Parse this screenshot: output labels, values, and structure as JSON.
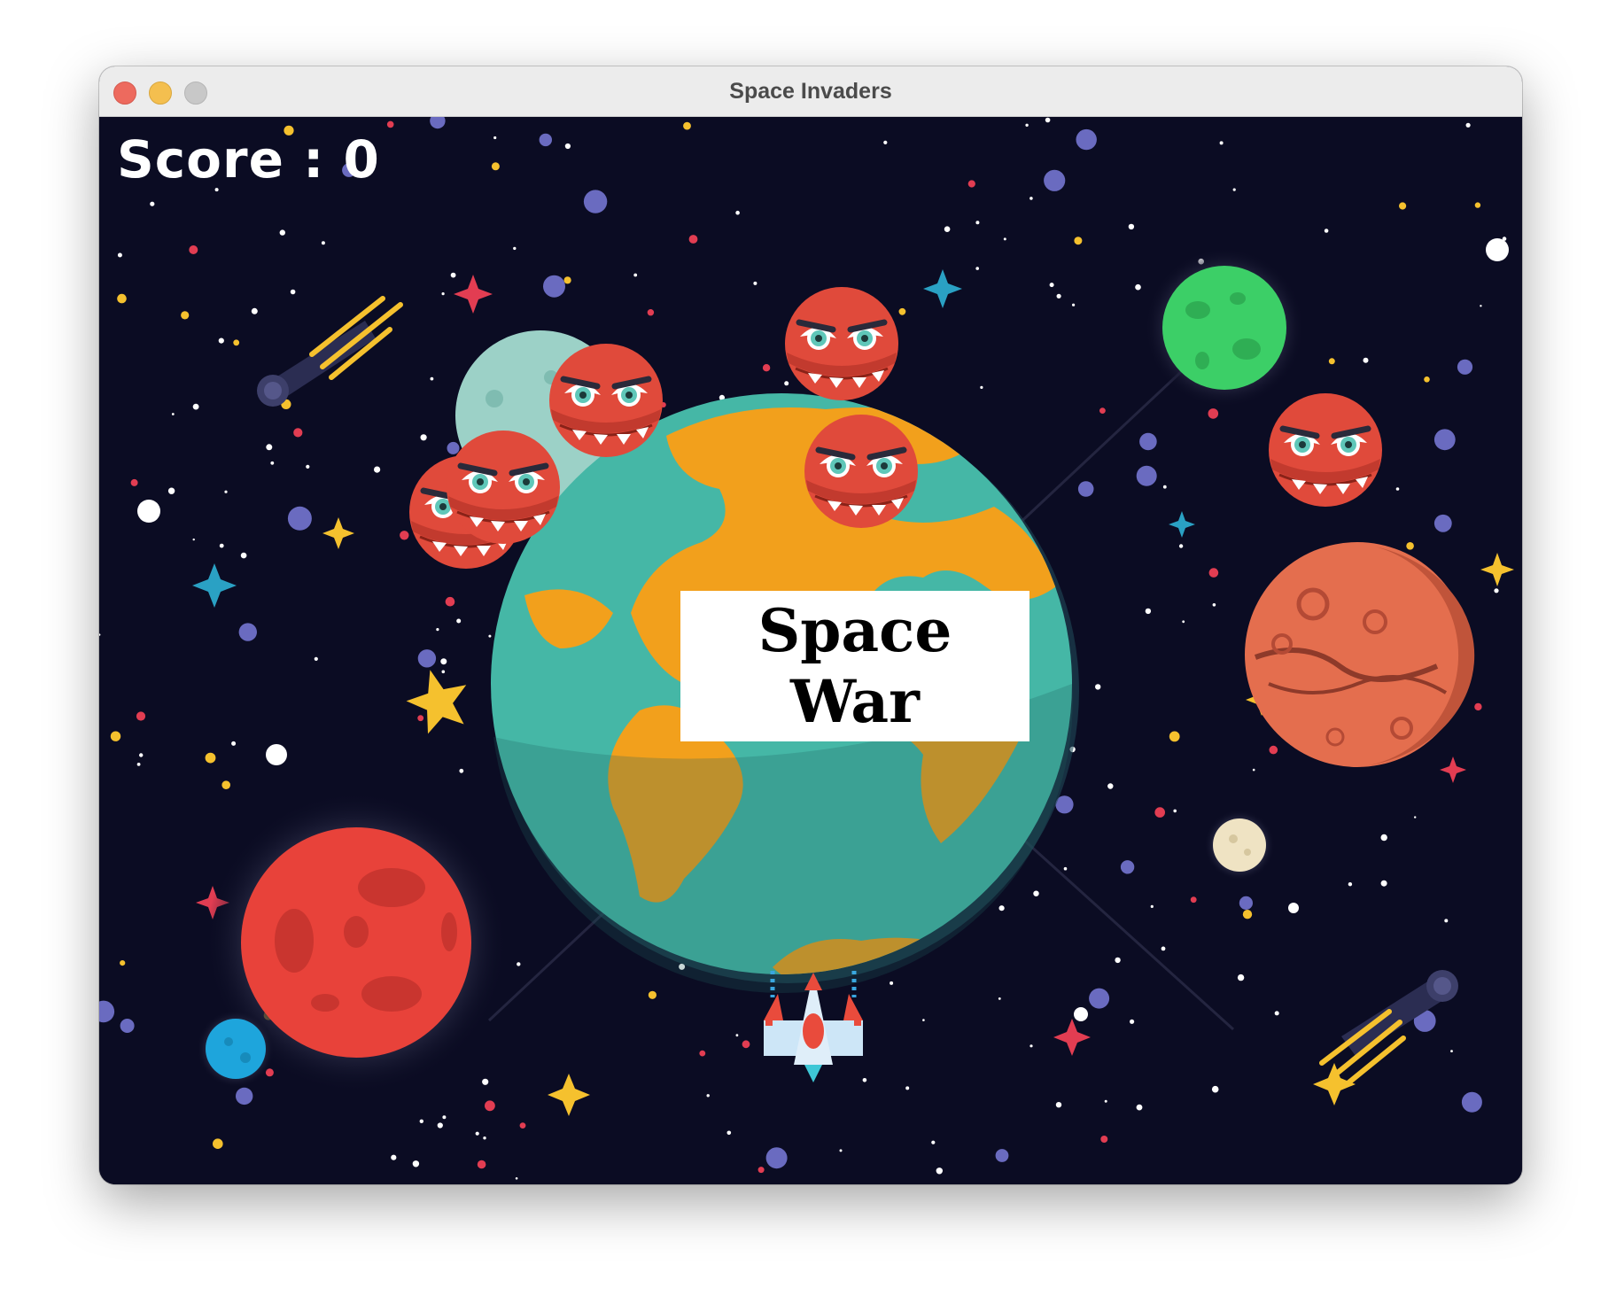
{
  "window": {
    "title": "Space Invaders"
  },
  "hud": {
    "score_text": "Score : 0"
  },
  "banner": {
    "line1": "Space",
    "line2": "War"
  },
  "colors": {
    "background": "#0b0c23",
    "enemy": "#e04a3b",
    "earth_ocean": "#45b7a6",
    "earth_land": "#f2a01c"
  },
  "enemies": {
    "count": 6
  }
}
